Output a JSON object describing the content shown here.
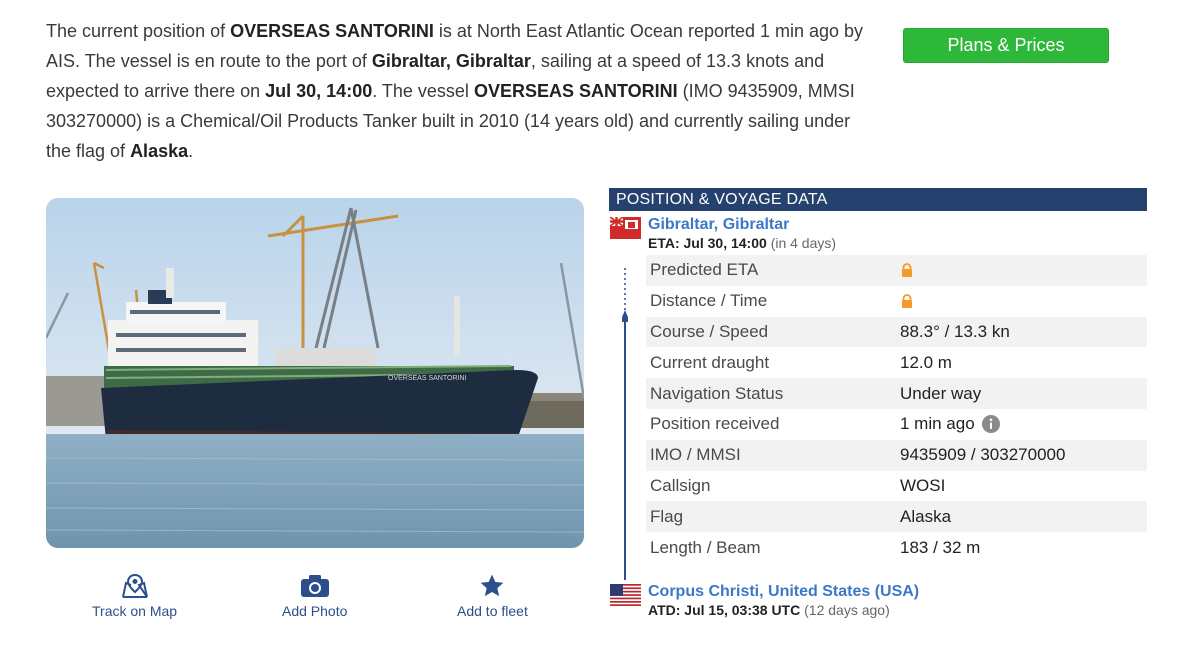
{
  "intro": {
    "p1": "The current position of ",
    "vessel_name": "OVERSEAS SANTORINI",
    "p2": " is at North East Atlantic Ocean reported 1 min ago by AIS. The vessel is en route to the port of ",
    "dest_port": "Gibraltar, Gibraltar",
    "p3": ", sailing at a speed of 13.3 knots and expected to arrive there on ",
    "eta": "Jul 30, 14:00",
    "p4": ". The vessel ",
    "vessel_name2": "OVERSEAS SANTORINI",
    "p5": " (IMO 9435909, MMSI 303270000) is a Chemical/Oil Products Tanker built in 2010 (14 years old) and currently sailing under the flag of ",
    "flag": "Alaska",
    "p6": "."
  },
  "plans_button": "Plans & Prices",
  "photo": {
    "hull_text": "OVERSEAS SANTORINI"
  },
  "actions": {
    "track": "Track on Map",
    "photo": "Add Photo",
    "fleet": "Add to fleet"
  },
  "panel": {
    "title": "POSITION & VOYAGE DATA",
    "destination": {
      "name": "Gibraltar, Gibraltar",
      "eta_label": "ETA: Jul 30, 14:00",
      "eta_rel": "(in 4 days)"
    },
    "rows": [
      {
        "label": "Predicted ETA",
        "value": ""
      },
      {
        "label": "Distance / Time",
        "value": ""
      },
      {
        "label": "Course / Speed",
        "value": "88.3° / 13.3 kn"
      },
      {
        "label": "Current draught",
        "value": "12.0 m"
      },
      {
        "label": "Navigation Status",
        "value": "Under way"
      },
      {
        "label": "Position received",
        "value": "1 min ago"
      },
      {
        "label": "IMO / MMSI",
        "value": "9435909 / 303270000"
      },
      {
        "label": "Callsign",
        "value": "WOSI"
      },
      {
        "label": "Flag",
        "value": "Alaska"
      },
      {
        "label": "Length / Beam",
        "value": "183 / 32 m"
      }
    ],
    "origin": {
      "name": "Corpus Christi, United States (USA)",
      "atd_label": "ATD: Jul 15, 03:38 UTC",
      "atd_rel": "(12 days ago)"
    }
  },
  "colors": {
    "accent_green": "#2eb83a",
    "header_navy": "#25426e",
    "link_blue": "#3b78c8",
    "lock_orange": "#f39a2b"
  }
}
